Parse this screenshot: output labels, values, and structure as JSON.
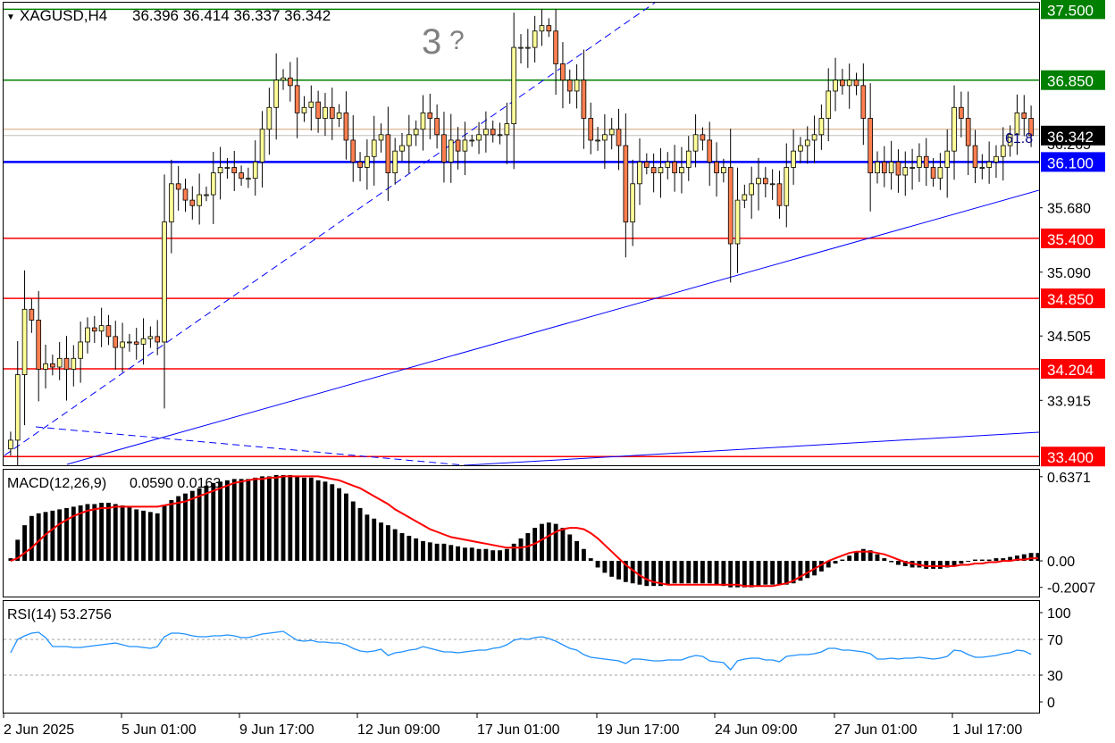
{
  "header": {
    "symbol": "XAGUSD,H4",
    "ohlc": "36.396 36.414 36.337 36.342",
    "wave_label": "3",
    "wave_label_suffix": "?"
  },
  "chart_data": [
    {
      "type": "candlestick",
      "title": "XAGUSD,H4",
      "ohlc_last": {
        "open": 36.396,
        "high": 36.414,
        "low": 36.337,
        "close": 36.342
      },
      "ylim": [
        33.32,
        37.56
      ],
      "y_ticks": [
        "35.680",
        "35.090",
        "34.505",
        "33.915"
      ],
      "x_ticks": [
        "2 Jun 2025",
        "5 Jun 01:00",
        "9 Jun 17:00",
        "12 Jun 09:00",
        "17 Jun 01:00",
        "19 Jun 17:00",
        "24 Jun 09:00",
        "27 Jun 01:00",
        "1 Jul 17:00"
      ],
      "levels": [
        {
          "value": 37.5,
          "label": "37.500",
          "color": "#008000"
        },
        {
          "value": 36.85,
          "label": "36.850",
          "color": "#008000"
        },
        {
          "value": 36.1,
          "label": "36.100",
          "color": "#0000ff"
        },
        {
          "value": 35.4,
          "label": "35.400",
          "color": "#ff0000"
        },
        {
          "value": 34.85,
          "label": "34.850",
          "color": "#ff0000"
        },
        {
          "value": 34.204,
          "label": "34.204",
          "color": "#ff0000"
        },
        {
          "value": 33.4,
          "label": "33.400",
          "color": "#ff0000"
        }
      ],
      "current_price": {
        "value": 36.342,
        "label": "36.342"
      },
      "fib_label": "61.8",
      "hidden_tick": "36.265",
      "partial_tick": "36.857",
      "closes": [
        33.55,
        34.15,
        34.75,
        34.65,
        34.2,
        34.25,
        34.22,
        34.3,
        34.2,
        34.3,
        34.45,
        34.58,
        34.55,
        34.6,
        34.5,
        34.4,
        34.45,
        34.45,
        34.43,
        34.48,
        34.5,
        34.45,
        35.55,
        35.9,
        35.85,
        35.75,
        35.7,
        35.8,
        35.8,
        36.0,
        36.05,
        36.05,
        36.0,
        35.95,
        35.95,
        36.1,
        36.4,
        36.6,
        36.85,
        36.87,
        36.8,
        36.55,
        36.6,
        36.65,
        36.5,
        36.6,
        36.5,
        36.55,
        36.3,
        36.1,
        36.05,
        36.15,
        36.3,
        36.35,
        36.0,
        36.2,
        36.25,
        36.35,
        36.4,
        36.55,
        36.5,
        36.35,
        36.1,
        36.3,
        36.2,
        36.3,
        36.3,
        36.35,
        36.4,
        36.35,
        36.35,
        36.45,
        37.15,
        37.15,
        37.15,
        37.3,
        37.35,
        37.3,
        37.0,
        36.85,
        36.75,
        36.85,
        36.5,
        36.3,
        36.3,
        36.35,
        36.4,
        36.25,
        35.55,
        35.9,
        36.1,
        36.05,
        36.0,
        36.05,
        36.1,
        36.0,
        36.05,
        36.2,
        36.35,
        36.3,
        36.1,
        36.0,
        36.05,
        35.35,
        35.75,
        35.8,
        35.9,
        35.95,
        35.9,
        35.9,
        35.7,
        36.05,
        36.2,
        36.25,
        36.3,
        36.35,
        36.5,
        36.75,
        36.85,
        36.8,
        36.85,
        36.8,
        36.5,
        36.0,
        36.1,
        36.0,
        36.1,
        35.98,
        36.05,
        36.05,
        36.15,
        36.05,
        35.95,
        36.05,
        36.2,
        36.6,
        36.5,
        36.25,
        36.05,
        36.05,
        36.1,
        36.15,
        36.25,
        36.35,
        36.55,
        36.5,
        36.342
      ],
      "macd": {
        "label": "MACD(12,26,9)",
        "values_text": "0.0590 0.0163",
        "ylim": [
          -0.27,
          0.69
        ],
        "y_ticks": [
          "0.6371",
          "0.00",
          "-0.2007"
        ],
        "histogram": [
          0.02,
          0.16,
          0.27,
          0.34,
          0.36,
          0.37,
          0.38,
          0.39,
          0.4,
          0.41,
          0.42,
          0.43,
          0.43,
          0.44,
          0.44,
          0.43,
          0.42,
          0.41,
          0.39,
          0.38,
          0.37,
          0.36,
          0.42,
          0.46,
          0.49,
          0.51,
          0.53,
          0.55,
          0.57,
          0.59,
          0.6,
          0.61,
          0.62,
          0.62,
          0.62,
          0.63,
          0.64,
          0.64,
          0.65,
          0.65,
          0.65,
          0.64,
          0.63,
          0.63,
          0.61,
          0.6,
          0.58,
          0.55,
          0.51,
          0.45,
          0.4,
          0.35,
          0.32,
          0.29,
          0.27,
          0.24,
          0.21,
          0.19,
          0.17,
          0.15,
          0.14,
          0.13,
          0.13,
          0.12,
          0.11,
          0.1,
          0.1,
          0.09,
          0.09,
          0.08,
          0.08,
          0.09,
          0.13,
          0.17,
          0.21,
          0.25,
          0.28,
          0.29,
          0.28,
          0.25,
          0.2,
          0.15,
          0.09,
          0.02,
          -0.05,
          -0.09,
          -0.12,
          -0.14,
          -0.16,
          -0.17,
          -0.18,
          -0.19,
          -0.19,
          -0.19,
          -0.18,
          -0.17,
          -0.17,
          -0.17,
          -0.17,
          -0.17,
          -0.17,
          -0.18,
          -0.19,
          -0.2,
          -0.2,
          -0.2,
          -0.2,
          -0.19,
          -0.18,
          -0.18,
          -0.18,
          -0.18,
          -0.17,
          -0.15,
          -0.13,
          -0.11,
          -0.08,
          -0.05,
          -0.02,
          0.01,
          0.04,
          0.07,
          0.09,
          0.08,
          0.05,
          0.02,
          -0.01,
          -0.03,
          -0.04,
          -0.05,
          -0.05,
          -0.06,
          -0.06,
          -0.06,
          -0.05,
          -0.04,
          -0.02,
          0.0,
          0.01,
          0.01,
          0.01,
          0.02,
          0.02,
          0.03,
          0.04,
          0.05,
          0.06,
          0.06
        ],
        "signal": [
          0.0,
          0.02,
          0.06,
          0.1,
          0.15,
          0.2,
          0.24,
          0.28,
          0.31,
          0.34,
          0.36,
          0.38,
          0.39,
          0.4,
          0.4,
          0.41,
          0.41,
          0.41,
          0.41,
          0.41,
          0.41,
          0.41,
          0.42,
          0.43,
          0.44,
          0.45,
          0.47,
          0.49,
          0.51,
          0.53,
          0.55,
          0.57,
          0.59,
          0.6,
          0.61,
          0.62,
          0.62,
          0.63,
          0.63,
          0.64,
          0.64,
          0.64,
          0.64,
          0.64,
          0.64,
          0.63,
          0.62,
          0.61,
          0.59,
          0.57,
          0.55,
          0.52,
          0.49,
          0.46,
          0.43,
          0.39,
          0.36,
          0.33,
          0.3,
          0.27,
          0.24,
          0.22,
          0.2,
          0.18,
          0.17,
          0.16,
          0.15,
          0.14,
          0.13,
          0.12,
          0.11,
          0.1,
          0.1,
          0.1,
          0.11,
          0.13,
          0.16,
          0.19,
          0.22,
          0.24,
          0.25,
          0.25,
          0.24,
          0.21,
          0.17,
          0.12,
          0.07,
          0.02,
          -0.03,
          -0.07,
          -0.11,
          -0.14,
          -0.16,
          -0.17,
          -0.18,
          -0.18,
          -0.18,
          -0.18,
          -0.18,
          -0.18,
          -0.18,
          -0.18,
          -0.18,
          -0.18,
          -0.18,
          -0.19,
          -0.19,
          -0.19,
          -0.19,
          -0.19,
          -0.18,
          -0.17,
          -0.15,
          -0.12,
          -0.09,
          -0.06,
          -0.03,
          0.0,
          0.02,
          0.04,
          0.06,
          0.07,
          0.07,
          0.07,
          0.06,
          0.05,
          0.03,
          0.01,
          -0.01,
          -0.02,
          -0.03,
          -0.04,
          -0.04,
          -0.04,
          -0.04,
          -0.04,
          -0.03,
          -0.03,
          -0.02,
          -0.02,
          -0.01,
          -0.01,
          0.0,
          0.0,
          0.01,
          0.01,
          0.02,
          0.02
        ]
      },
      "rsi": {
        "label": "RSI(14)",
        "value_text": "53.2756",
        "ylim": [
          0,
          100
        ],
        "y_ticks": [
          "100",
          "70",
          "30",
          "0"
        ],
        "levels": [
          70,
          30
        ],
        "values": [
          55,
          70,
          74,
          77,
          78,
          72,
          62,
          62,
          62,
          61,
          61,
          62,
          63,
          64,
          65,
          66,
          64,
          62,
          62,
          61,
          60,
          62,
          73,
          77,
          77,
          76,
          74,
          73,
          73,
          74,
          74,
          75,
          74,
          72,
          72,
          74,
          76,
          77,
          78,
          79,
          74,
          69,
          68,
          69,
          67,
          67,
          66,
          66,
          64,
          60,
          57,
          56,
          57,
          59,
          52,
          55,
          56,
          58,
          59,
          62,
          60,
          58,
          56,
          56,
          55,
          56,
          57,
          58,
          58,
          60,
          61,
          64,
          69,
          71,
          70,
          72,
          73,
          71,
          68,
          64,
          60,
          58,
          53,
          50,
          49,
          48,
          47,
          46,
          43,
          48,
          48,
          47,
          46,
          46,
          47,
          47,
          47,
          50,
          52,
          51,
          46,
          45,
          44,
          36,
          46,
          48,
          49,
          49,
          47,
          47,
          45,
          51,
          52,
          53,
          53,
          54,
          56,
          60,
          60,
          58,
          58,
          57,
          56,
          54,
          48,
          48,
          49,
          48,
          49,
          49,
          50,
          49,
          48,
          49,
          51,
          58,
          57,
          53,
          50,
          50,
          51,
          52,
          54,
          55,
          58,
          57,
          53.2756
        ]
      }
    }
  ]
}
